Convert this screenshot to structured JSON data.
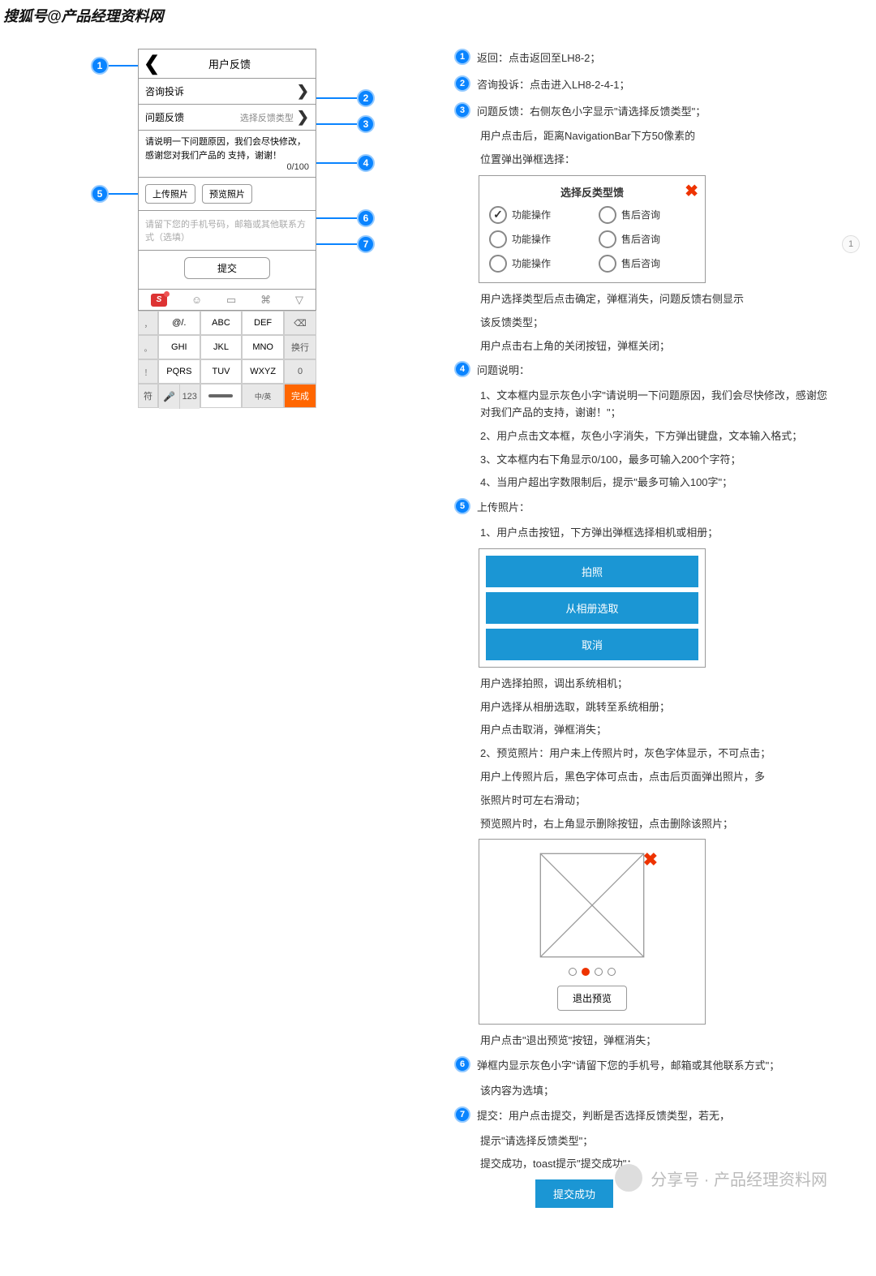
{
  "watermark": "搜狐号@产品经理资料网",
  "page_indicator": "1",
  "mockup": {
    "nav_title": "用户反馈",
    "row1_label": "咨询投诉",
    "row2_label": "问题反馈",
    "row2_hint": "选择反馈类型",
    "desc_placeholder": "请说明一下问题原因，我们会尽快修改，感谢您对我们产品的 支持，谢谢！",
    "char_count": "0/100",
    "upload_btn": "上传照片",
    "preview_btn": "预览照片",
    "contact_placeholder": "请留下您的手机号码，邮箱或其他联系方式（选填）",
    "submit_btn": "提交"
  },
  "keyboard": {
    "r1": [
      "，",
      "@/.",
      "ABC",
      "DEF",
      "⌫"
    ],
    "r2": [
      "。",
      "GHI",
      "JKL",
      "MNO",
      "换行"
    ],
    "r3": [
      "！",
      "PQRS",
      "TUV",
      "WXYZ",
      "0"
    ],
    "r4_left": "符",
    "r4_mic": "🎤",
    "r4_123": "123",
    "r4_cn": "中/英",
    "r4_done": "完成"
  },
  "annotations": {
    "a1": "返回：点击返回至LH8-2；",
    "a2": "咨询投诉：点击进入LH8-2-4-1；",
    "a3": "问题反馈：右侧灰色小字显示\"请选择反馈类型\"；",
    "a3b": "用户点击后，距离NavigationBar下方50像素的",
    "a3c": "位置弹出弹框选择：",
    "popup_title": "选择反类型馈",
    "radio_left": "功能操作",
    "radio_right": "售后咨询",
    "a3d": "用户选择类型后点击确定，弹框消失，问题反馈右侧显示",
    "a3e": "该反馈类型；",
    "a3f": "用户点击右上角的关闭按钮，弹框关闭；",
    "a4": "问题说明：",
    "a4_1": "1、文本框内显示灰色小字\"请说明一下问题原因，我们会尽快修改，感谢您对我们产品的支持，谢谢！\"；",
    "a4_2": "2、用户点击文本框，灰色小字消失，下方弹出键盘，文本输入格式；",
    "a4_3": "3、文本框内右下角显示0/100，最多可输入200个字符；",
    "a4_4": "4、当用户超出字数限制后，提示\"最多可输入100字\"；",
    "a5": "上传照片：",
    "a5_1": "1、用户点击按钮，下方弹出弹框选择相机或相册；",
    "sheet_camera": "拍照",
    "sheet_album": "从相册选取",
    "sheet_cancel": "取消",
    "a5_2": "用户选择拍照，调出系统相机；",
    "a5_3": "用户选择从相册选取，跳转至系统相册；",
    "a5_4": "用户点击取消，弹框消失；",
    "a5_5": "2、预览照片：用户未上传照片时，灰色字体显示，不可点击；",
    "a5_6": "用户上传照片后，黑色字体可点击，点击后页面弹出照片，多",
    "a5_7": "张照片时可左右滑动；",
    "a5_8": "预览照片时，右上角显示删除按钮，点击删除该照片；",
    "exit_preview": "退出预览",
    "a5_9": "用户点击\"退出预览\"按钮，弹框消失；",
    "a6": "弹框内显示灰色小字\"请留下您的手机号，邮箱或其他联系方式\"；",
    "a6_1": "该内容为选填；",
    "a7": "提交：用户点击提交，判断是否选择反馈类型，若无，",
    "a7_1": "提示\"请选择反馈类型\"；",
    "a7_2": "提交成功，toast提示\"提交成功\"；",
    "toast": "提交成功"
  },
  "footer_wm": "分享号 · 产品经理资料网"
}
